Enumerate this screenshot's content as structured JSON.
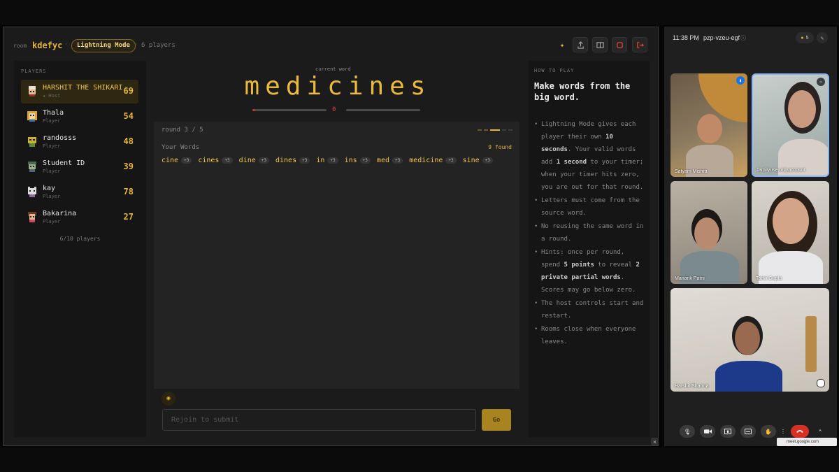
{
  "header": {
    "room_label": "room",
    "room_code": "kdefyc",
    "separator": "·",
    "mode": "Lightning Mode",
    "player_count": "6 players"
  },
  "players_panel": {
    "label": "PLAYERS",
    "players": [
      {
        "name": "HARSHIT THE SHIKARI",
        "role": "★ Host",
        "score": "69",
        "avatar": "chef-avatar-icon"
      },
      {
        "name": "Thala",
        "role": "Player",
        "score": "54",
        "avatar": "lion-avatar-icon"
      },
      {
        "name": "randosss",
        "role": "Player",
        "score": "48",
        "avatar": "alien-avatar-icon"
      },
      {
        "name": "Student ID",
        "role": "Player",
        "score": "39",
        "avatar": "goblin-avatar-icon"
      },
      {
        "name": "kay",
        "role": "Player",
        "score": "78",
        "avatar": "cat-avatar-icon"
      },
      {
        "name": "Bakarina",
        "role": "Player",
        "score": "27",
        "avatar": "girl-avatar-icon"
      }
    ],
    "count": "6/10 players"
  },
  "center": {
    "current_word_label": "current word",
    "word": "medicines",
    "timer": "0",
    "round": "round 3 / 5",
    "your_words_label": "Your Words",
    "found": "9 found",
    "words": [
      {
        "w": "cine",
        "s": "+3"
      },
      {
        "w": "cines",
        "s": "+3"
      },
      {
        "w": "dine",
        "s": "+3"
      },
      {
        "w": "dines",
        "s": "+3"
      },
      {
        "w": "in",
        "s": "+3"
      },
      {
        "w": "ins",
        "s": "+3"
      },
      {
        "w": "med",
        "s": "+3"
      },
      {
        "w": "medicine",
        "s": "+3"
      },
      {
        "w": "sine",
        "s": "+3"
      }
    ],
    "input_placeholder": "Rejoin to submit",
    "go_label": "Go"
  },
  "how_to_play": {
    "label": "HOW TO PLAY",
    "title": "Make words from the big word.",
    "rules": [
      {
        "parts": [
          "Lightning Mode gives each player their own ",
          "10 seconds",
          ". Your valid words add ",
          "1 second",
          " to your timer; when your timer hits zero, you are out for that round."
        ]
      },
      {
        "parts": [
          "Letters must come from the source word."
        ]
      },
      {
        "parts": [
          "No reusing the same word in a round."
        ]
      },
      {
        "parts": [
          "Hints: once per round, spend ",
          "5 points",
          " to reveal ",
          "2 private partial words",
          ". Scores may go below zero."
        ]
      },
      {
        "parts": [
          "The host controls start and restart."
        ]
      },
      {
        "parts": [
          "Rooms close when everyone leaves."
        ]
      }
    ]
  },
  "meet": {
    "time": "11:38 PM",
    "divider": "|",
    "code": "pzp-vzeu-egf",
    "people_count": "5",
    "participants": [
      "Satyam Mishra",
      "familyuse.onlyaccount",
      "Manank Patni",
      "Tanvi Gupta",
      "Harshit Sharma"
    ],
    "toast": "meet.google.com"
  },
  "colors": {
    "accent": "#e5b53a",
    "background": "#1b1b1b",
    "panel": "#151515",
    "end_call": "#d93025"
  }
}
